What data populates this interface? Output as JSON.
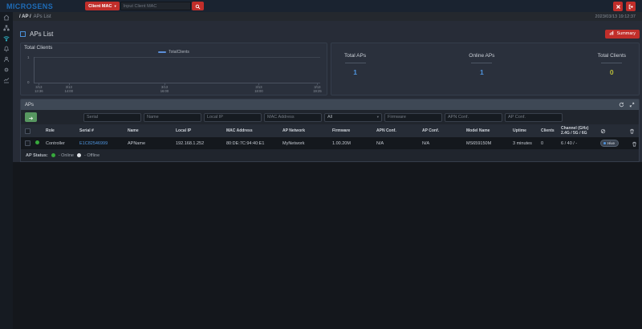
{
  "topbar": {
    "brand": "MICROSENS",
    "search_type": "Client MAC",
    "search_placeholder": "Input Client MAC"
  },
  "breadcrumb": {
    "section": "/ AP /",
    "page": "APs List",
    "timestamp": "2023/03/13 19:12:37"
  },
  "sidebar": {
    "items": [
      "home",
      "topology",
      "wireless",
      "notifications",
      "users",
      "settings",
      "statistics"
    ],
    "active": "wireless"
  },
  "page": {
    "title": "APs List",
    "summary_button": "Summary"
  },
  "chart_data": {
    "type": "line",
    "title": "Total Clients",
    "legend": [
      "TotalClients"
    ],
    "legend_position": "top-center",
    "series": [
      {
        "name": "TotalClients",
        "color": "#5b8fd9",
        "values": [
          0,
          0,
          0,
          0,
          0
        ]
      }
    ],
    "x": [
      "3/13 13:36",
      "3/13 14:00",
      "3/13 16:00",
      "3/13 18:00",
      "3/13 19:25"
    ],
    "ticks": [
      {
        "date": "3/13",
        "time": "13:36",
        "pos": "1.5%"
      },
      {
        "date": "3/13",
        "time": "14:00",
        "pos": "12%"
      },
      {
        "date": "3/13",
        "time": "16:00",
        "pos": "45.5%"
      },
      {
        "date": "3/13",
        "time": "18:00",
        "pos": "78.5%"
      },
      {
        "date": "3/13",
        "time": "19:25",
        "pos": "99%"
      }
    ],
    "ylim": [
      0,
      1
    ],
    "yticks": {
      "top": "1",
      "bottom": "0"
    },
    "grid": true
  },
  "stats": [
    {
      "label": "Total APs",
      "value": "1",
      "color": "#4f94dd"
    },
    {
      "label": "Online APs",
      "value": "1",
      "color": "#4f94dd"
    },
    {
      "label": "Total Clients",
      "value": "0",
      "color": "#b9bd3a"
    }
  ],
  "aps_panel": {
    "title": "APs",
    "filters": [
      {
        "placeholder": "Serial"
      },
      {
        "placeholder": "Name"
      },
      {
        "placeholder": "Local IP"
      },
      {
        "placeholder": "MAC Address"
      },
      {
        "value": "All"
      },
      {
        "placeholder": "Firmware"
      },
      {
        "placeholder": "APN Conf."
      },
      {
        "placeholder": "AP Conf."
      }
    ],
    "columns": [
      "Role",
      "Serial #",
      "Name",
      "Local IP",
      "MAC Address",
      "AP Network",
      "Firmware",
      "APN Conf.",
      "AP Conf.",
      "Model Name",
      "Uptime",
      "Clients"
    ],
    "channel_column": {
      "line1": "Channel (GHz)",
      "line2": "2.4G / 5G / 6G"
    },
    "rows": [
      {
        "status": "online",
        "role": "Controller",
        "serial": "E1C82546999",
        "name": "APName",
        "local_ip": "192.168.1.252",
        "mac": "80:DE:7C:94:40:E1",
        "ap_network": "MyNetwork",
        "firmware": "1.00.20M",
        "apn_conf": "N/A",
        "ap_conf": "N/A",
        "model": "MS659150M",
        "uptime": "3 minutes",
        "clients": "0",
        "channel": "6 / 40 / -",
        "toggle_label": "Hive"
      }
    ],
    "legend": {
      "label": "AP Status:",
      "online": "- Online",
      "offline": "- Offline"
    }
  },
  "colors": {
    "accent_red": "#c12e2a",
    "brand_blue": "#1e6cb8",
    "link_blue": "#4f94dd",
    "online_green": "#37a93c",
    "total_clients_yellow": "#b9bd3a",
    "active_icon_teal": "#2fb9cd"
  }
}
